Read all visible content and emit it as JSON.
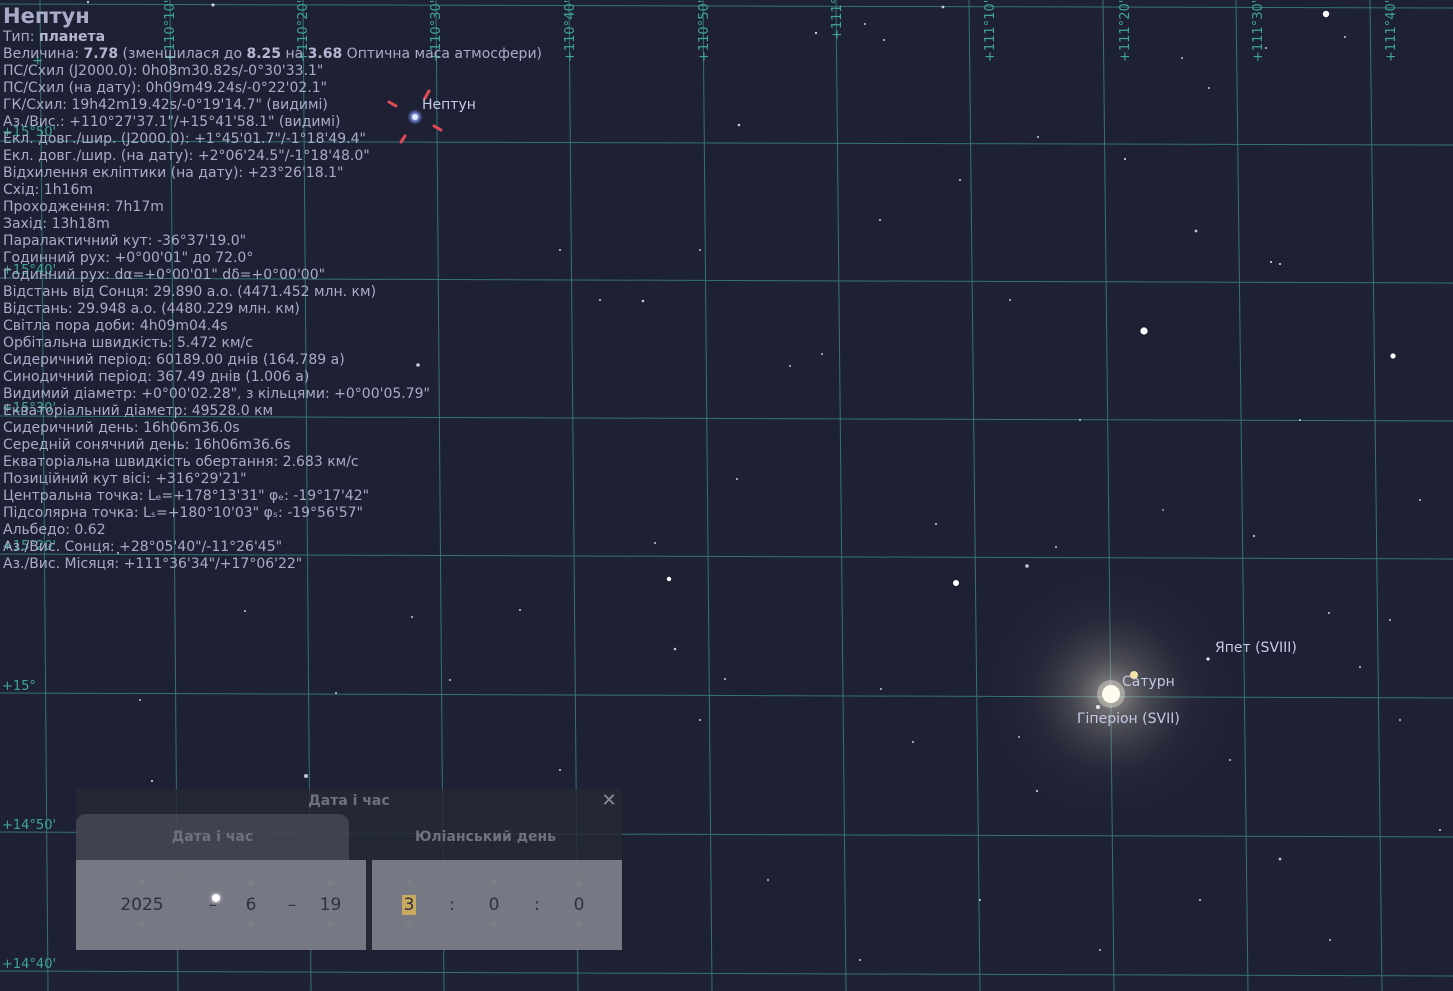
{
  "info": {
    "title": "Нептун",
    "lines": [
      "Тип: <b>планета</b>",
      "Величина: <b>7.78</b> (зменшилася до <b>8.25</b> на <b>3.68</b> Оптична маса атмосфери)",
      "ПС/Схил (J2000.0): 0h08m30.82s/-0°30'33.1\"",
      "ПС/Схил (на дату): 0h09m49.24s/-0°22'02.1\"",
      "ГК/Схил: 19h42m19.42s/-0°19'14.7\" (видимі)",
      "Аз./Вис.: +110°27'37.1\"/+15°41'58.1\" (видимі)",
      "Екл. довг./шир. (J2000.0): +1°45'01.7\"/-1°18'49.4\"",
      "Екл. довг./шир. (на дату): +2°06'24.5\"/-1°18'48.0\"",
      "Відхилення екліптики (на дату): +23°26'18.1\"",
      "Схід: 1h16m",
      "Проходження: 7h17m",
      "Захід: 13h18m",
      "Паралактичний кут: -36°37'19.0\"",
      "Годинний рух: +0°00'01\" до 72.0°",
      "Годинний рух: dα=+0°00'01\" dδ=+0°00'00\"",
      "Відстань від Сонця: 29.890 а.о. (4471.452 млн. км)",
      "Відстань: 29.948 а.о. (4480.229 млн. км)",
      "Світла пора доби: 4h09m04.4s",
      "Орбітальна швидкість: 5.472 км/с",
      "Сидеричний період: 60189.00 днів (164.789 a)",
      "Синодичний період: 367.49 днів (1.006 a)",
      "Видимий діаметр: +0°00'02.28\", з кільцями: +0°00'05.79\"",
      "Екваторіальний діаметр: 49528.0 км",
      "Сидеричний день: 16h06m36.0s",
      "Середній сонячний день: 16h06m36.6s",
      "Екваторіальна швидкість обертання: 2.683 км/с",
      "Позиційний кут вісі: +316°29'21\"",
      "Центральна точка: Lₑ=+178°13'31\" φₑ: -19°17'42\"",
      "Підсолярна точка: Lₛ=+180°10'03\" φₛ: -19°56'57\"",
      "Альбедо: 0.62",
      "Аз./Вис. Сонця: +28°05'40\"/-11°26'45\"",
      "Аз./Вис. Місяця: +111°36'34\"/+17°06'22\""
    ]
  },
  "sky": {
    "objects": [
      {
        "label": "Нептун"
      },
      {
        "label": "Сатурн"
      },
      {
        "label": "Гіперіон (SVII)"
      },
      {
        "label": "Япет (SVIII)"
      }
    ],
    "azimuth_labels": [
      "+110°10'",
      "+110°20'",
      "+110°30'",
      "+110°40'",
      "+110°50'",
      "+111°",
      "+111°10'",
      "+111°20'",
      "+111°30'",
      "+111°40'"
    ],
    "altitude_labels": [
      "+15°50'",
      "+15°40'",
      "+15°30'",
      "+15°20'",
      "+15°10'",
      "+15°",
      "+14°50'",
      "+14°40'"
    ],
    "colors": {
      "grid": "#3fa596",
      "background": "#1e2133",
      "neptune": "#8fa6ff",
      "marker": "#e24a55",
      "saturn_glow": "#e8dcc0"
    }
  },
  "dialog": {
    "title": "Дата і час",
    "close_icon": "close-icon",
    "tabs": [
      "Дата і час",
      "Юліанський день"
    ],
    "active_tab": 0,
    "date": {
      "year": "2025",
      "month": "6",
      "day": "19",
      "separator": "–"
    },
    "time": {
      "hour": "3",
      "minute": "0",
      "second": "0",
      "separator": ":"
    }
  }
}
